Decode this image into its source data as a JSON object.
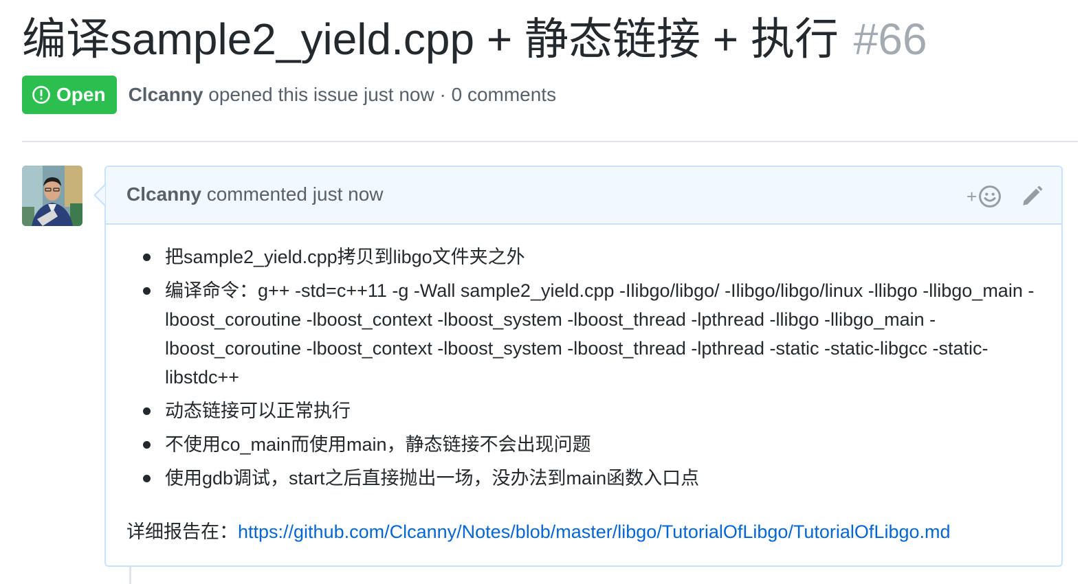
{
  "issue": {
    "title": "编译sample2_yield.cpp + 静态链接 + 执行",
    "number": "#66",
    "state": "Open",
    "author": "Clcanny",
    "meta_text": "opened this issue just now · 0 comments"
  },
  "comment": {
    "author": "Clcanny",
    "time_text": "commented just now",
    "reaction_plus": "+",
    "items": [
      "把sample2_yield.cpp拷贝到libgo文件夹之外",
      "编译命令：g++ -std=c++11 -g -Wall sample2_yield.cpp -Ilibgo/libgo/ -Ilibgo/libgo/linux -llibgo -llibgo_main -lboost_coroutine -lboost_context -lboost_system -lboost_thread -lpthread -llibgo -llibgo_main -lboost_coroutine -lboost_context -lboost_system -lboost_thread -lpthread -static -static-libgcc -static-libstdc++",
      "动态链接可以正常执行",
      "不使用co_main而使用main，静态链接不会出现问题",
      "使用gdb调试，start之后直接抛出一场，没办法到main函数入口点"
    ],
    "report_label": "详细报告在：",
    "report_link": "https://github.com/Clcanny/Notes/blob/master/libgo/TutorialOfLibgo/TutorialOfLibgo.md"
  },
  "icons": {
    "state": "issue-opened-icon",
    "reaction": "smiley-icon",
    "edit": "pencil-icon",
    "avatar": "user-avatar"
  },
  "colors": {
    "open_green": "#2cbe4e",
    "link_blue": "#0366d6",
    "header_bg": "#f1f8ff",
    "header_border": "#c8e1ff",
    "muted_text": "#586069",
    "number_gray": "#a3aab1"
  }
}
